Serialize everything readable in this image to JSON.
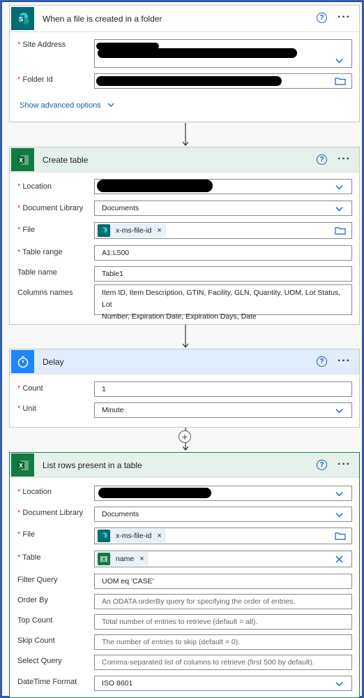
{
  "trigger": {
    "title": "When a file is created in a folder",
    "site_address_label": "Site Address",
    "folder_id_label": "Folder Id",
    "show_advanced": "Show advanced options"
  },
  "create_table": {
    "title": "Create table",
    "location_label": "Location",
    "doc_library_label": "Document Library",
    "doc_library_value": "Documents",
    "file_label": "File",
    "file_token": "x-ms-file-id",
    "table_range_label": "Table range",
    "table_range_value": "A1:L500",
    "table_name_label": "Table name",
    "table_name_value": "Table1",
    "columns_label": "Columns names",
    "columns_line1": "Item ID, Item Description, GTIN, Facility, GLN, Quantity, UOM, Lot Status, Lot",
    "columns_line2": "Number, Expiration Date, Expiration Days, Date"
  },
  "delay": {
    "title": "Delay",
    "count_label": "Count",
    "count_value": "1",
    "unit_label": "Unit",
    "unit_value": "Minute"
  },
  "list_rows": {
    "title": "List rows present in a table",
    "location_label": "Location",
    "doc_library_label": "Document Library",
    "doc_library_value": "Documents",
    "file_label": "File",
    "file_token": "x-ms-file-id",
    "table_label": "Table",
    "table_token": "name",
    "filter_label": "Filter Query",
    "filter_value": "UOM eq 'CASE'",
    "orderby_label": "Order By",
    "orderby_placeholder": "An ODATA orderBy query for specifying the order of entries.",
    "topcount_label": "Top Count",
    "topcount_placeholder": "Total number of entries to retrieve (default = all).",
    "skipcount_label": "Skip Count",
    "skipcount_placeholder": "The number of entries to skip (default = 0).",
    "select_label": "Select Query",
    "select_placeholder": "Comma-separated list of columns to retrieve (first 500 by default).",
    "datetime_label": "DateTime Format",
    "datetime_value": "ISO 8601"
  },
  "icons": {
    "sharepoint": "sharepoint-icon",
    "excel": "excel-icon",
    "delay": "timer-icon",
    "help": "help-icon",
    "more": "more-icon"
  },
  "colors": {
    "sharepoint_bg": "#036c70",
    "excel_bg": "#107c41",
    "delay_bg": "#1f85ff",
    "header_green": "#e6f0ea",
    "header_blue": "#e1ecfb",
    "accent": "#1a5fb4"
  }
}
